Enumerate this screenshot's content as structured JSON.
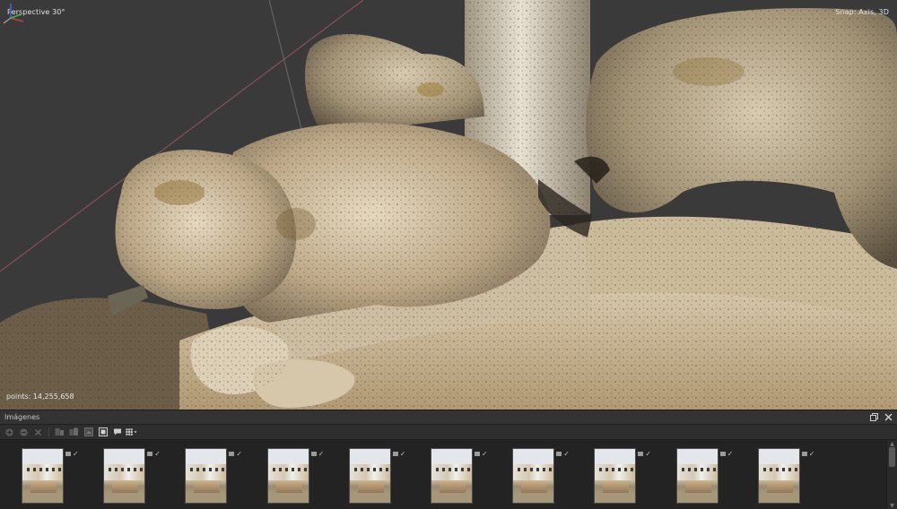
{
  "viewport": {
    "mode_label": "Perspective 30°",
    "snap_label": "Snap: Axis, 3D",
    "points_label": "points: 14,255,658"
  },
  "panel": {
    "title": "Imágenes",
    "thumbnails": [
      {
        "index": 1
      },
      {
        "index": 2
      },
      {
        "index": 3
      },
      {
        "index": 4
      },
      {
        "index": 5
      },
      {
        "index": 6
      },
      {
        "index": 7
      },
      {
        "index": 8
      },
      {
        "index": 9
      },
      {
        "index": 10
      }
    ]
  },
  "icons": {
    "toolbar": [
      "enable-icon",
      "disable-icon",
      "remove-icon",
      "align-icon",
      "align-all-icon",
      "mask-icon",
      "select-icon",
      "comment-icon",
      "grid-view-icon"
    ],
    "window": [
      "restore-icon",
      "close-icon"
    ],
    "check": "✓"
  },
  "colors": {
    "viewport_bg": "#3a3a3a",
    "panel_bg": "#262626",
    "axis_x": "#d63b3b",
    "axis_y": "#3bbd4b",
    "axis_z": "#3d64e0"
  }
}
